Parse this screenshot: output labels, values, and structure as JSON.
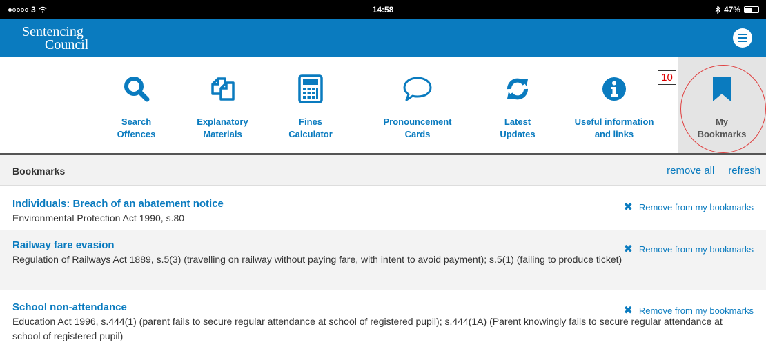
{
  "status_bar": {
    "carrier": "3",
    "time": "14:58",
    "battery": "47%"
  },
  "header": {
    "logo_line1": "Sentencing",
    "logo_line2": "Council"
  },
  "nav": {
    "items": [
      {
        "line1": "Search",
        "line2": "Offences",
        "icon": "search-icon"
      },
      {
        "line1": "Explanatory",
        "line2": "Materials",
        "icon": "documents-icon"
      },
      {
        "line1": "Fines",
        "line2": "Calculator",
        "icon": "calculator-icon"
      },
      {
        "line1": "Pronouncement",
        "line2": "Cards",
        "icon": "speech-bubble-icon"
      },
      {
        "line1": "Latest",
        "line2": "Updates",
        "icon": "refresh-icon"
      },
      {
        "line1": "Useful information",
        "line2": "and links",
        "icon": "info-icon"
      },
      {
        "line1": "My",
        "line2": "Bookmarks",
        "icon": "bookmark-icon",
        "active": true
      }
    ]
  },
  "annotation": {
    "number": "10"
  },
  "bookmarks": {
    "title": "Bookmarks",
    "remove_all": "remove all",
    "refresh": "refresh",
    "remove_label": "Remove from my bookmarks",
    "items": [
      {
        "title": "Individuals: Breach of an abatement notice",
        "desc": "Environmental Protection Act 1990, s.80"
      },
      {
        "title": "Railway fare evasion",
        "desc": "Regulation of Railways Act 1889, s.5(3) (travelling on railway without paying fare, with intent to avoid payment); s.5(1) (failing to produce ticket)"
      },
      {
        "title": "School non-attendance",
        "desc": "Education Act 1996, s.444(1) (parent fails to secure regular attendance at school of registered pupil); s.444(1A) (Parent knowingly fails to secure regular attendance at school of registered pupil)"
      }
    ]
  },
  "colors": {
    "brand": "#0a7bbf",
    "active_bg": "#e4e4e4",
    "annotation": "#e04040"
  }
}
